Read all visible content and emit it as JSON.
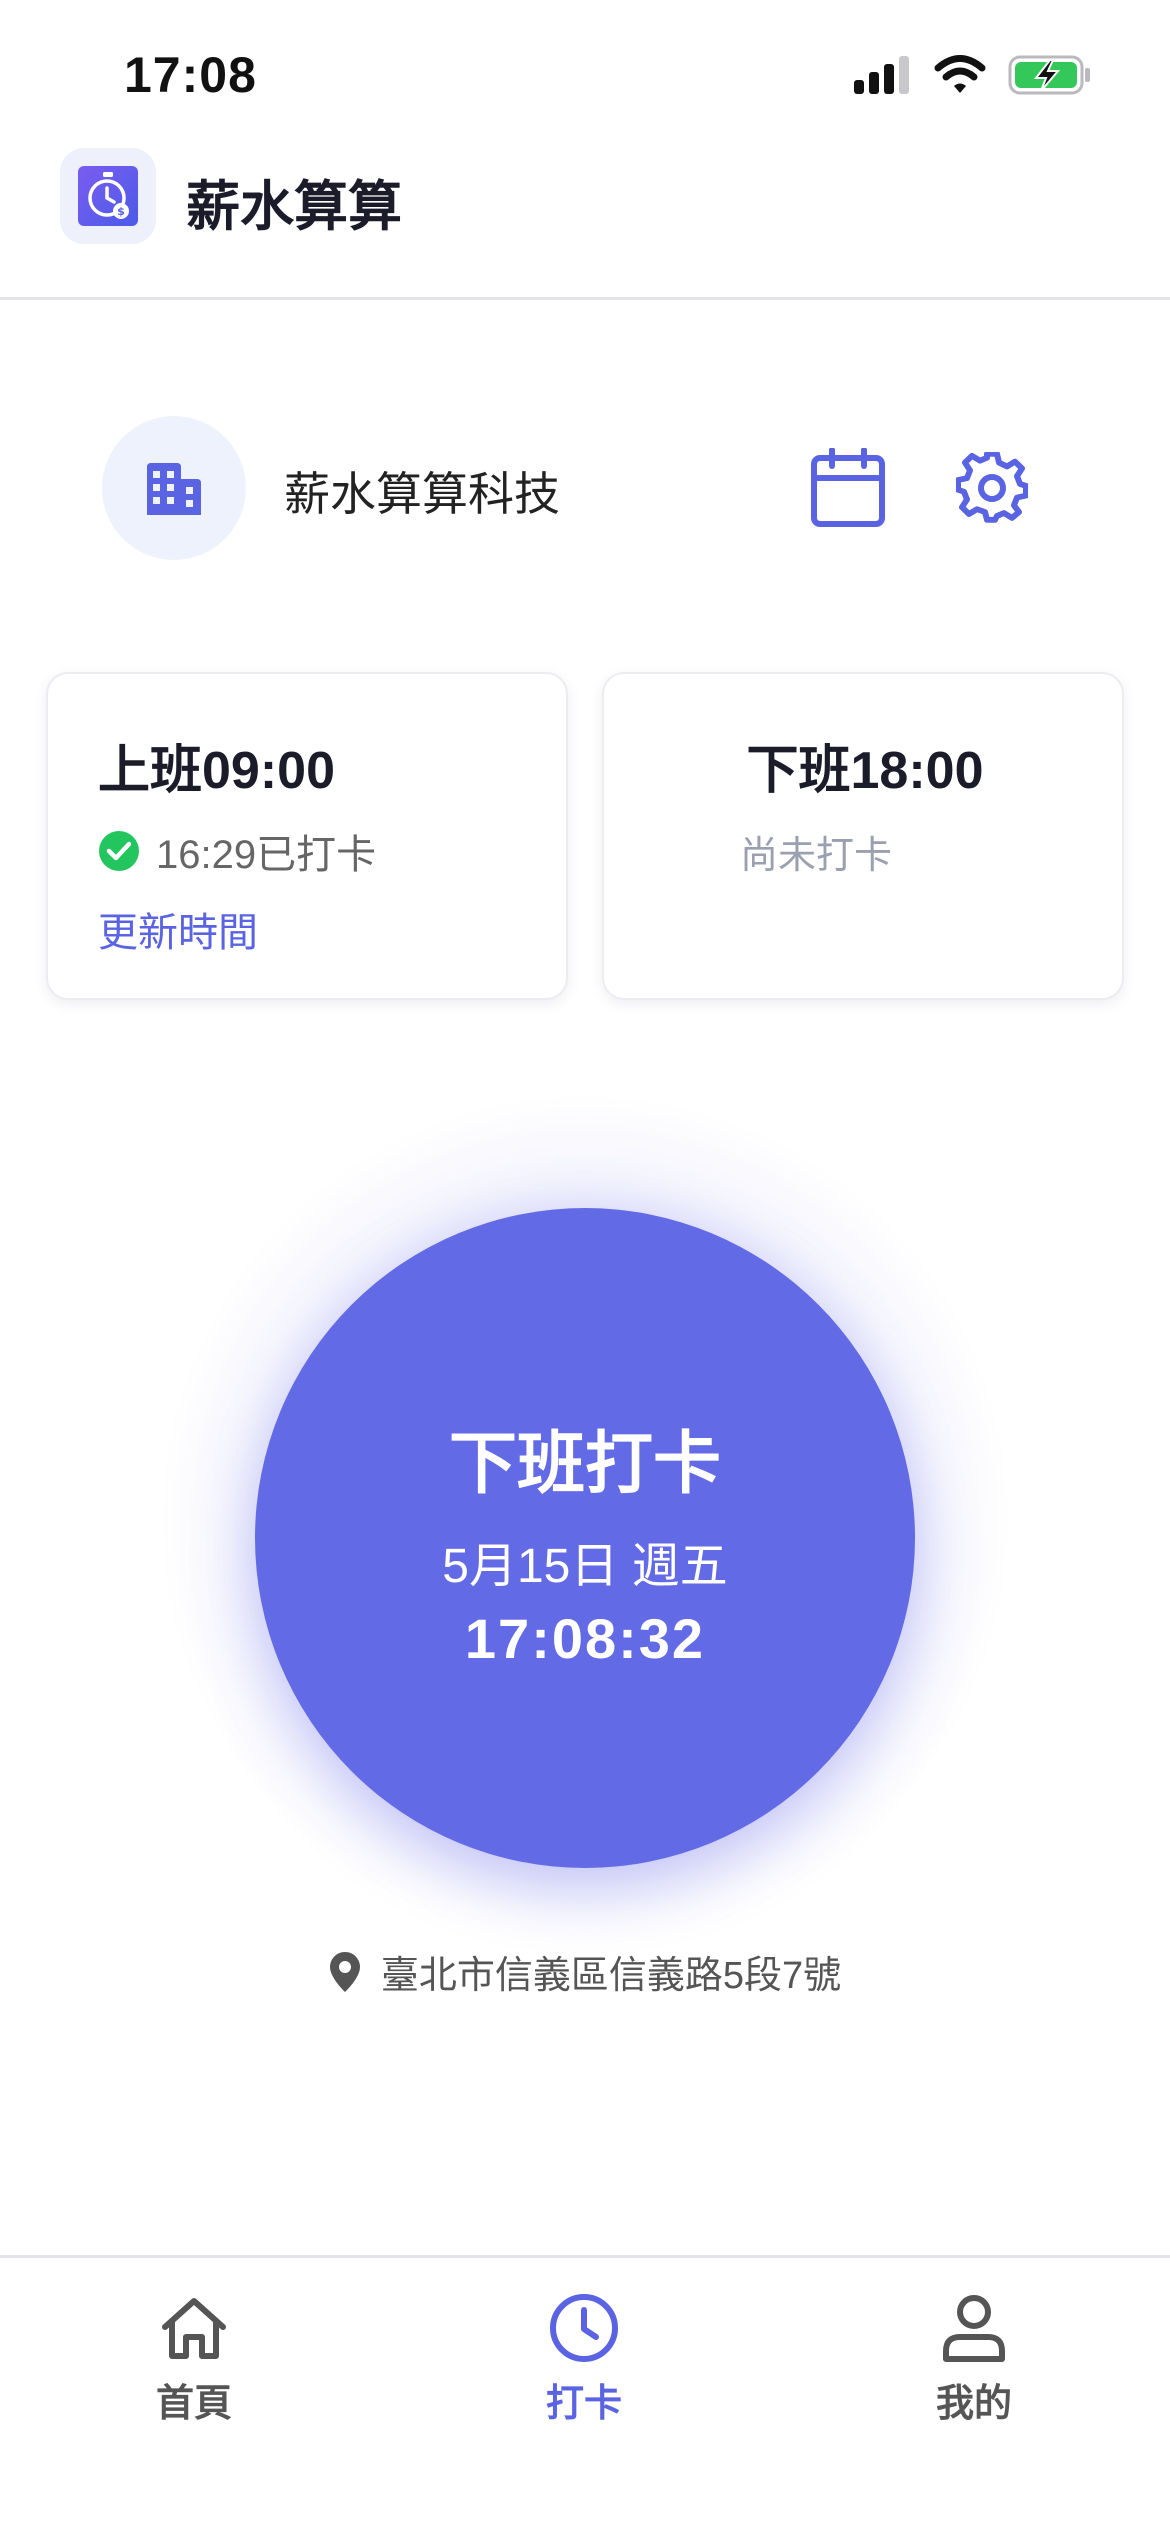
{
  "status_bar": {
    "time": "17:08"
  },
  "app": {
    "title": "薪水算算",
    "logo_icon": "stopwatch-dollar-icon"
  },
  "company": {
    "name": "薪水算算科技",
    "avatar_icon": "building-icon",
    "calendar_icon": "calendar-icon",
    "settings_icon": "gear-icon"
  },
  "cards": {
    "clock_in": {
      "title": "上班09:00",
      "status": "16:29已打卡",
      "status_icon": "check-circle-icon",
      "link": "更新時間"
    },
    "clock_out": {
      "title": "下班18:00",
      "status": "尚未打卡"
    }
  },
  "punch": {
    "label": "下班打卡",
    "date": "5月15日 週五",
    "time": "17:08:32"
  },
  "location": {
    "icon": "map-pin-icon",
    "address": "臺北市信義區信義路5段7號"
  },
  "nav": {
    "items": [
      {
        "label": "首頁",
        "icon": "home-icon",
        "active": false
      },
      {
        "label": "打卡",
        "icon": "clock-icon",
        "active": true
      },
      {
        "label": "我的",
        "icon": "user-icon",
        "active": false
      }
    ]
  },
  "colors": {
    "accent": "#636ae6",
    "success": "#22c55e",
    "battery": "#34c759"
  }
}
